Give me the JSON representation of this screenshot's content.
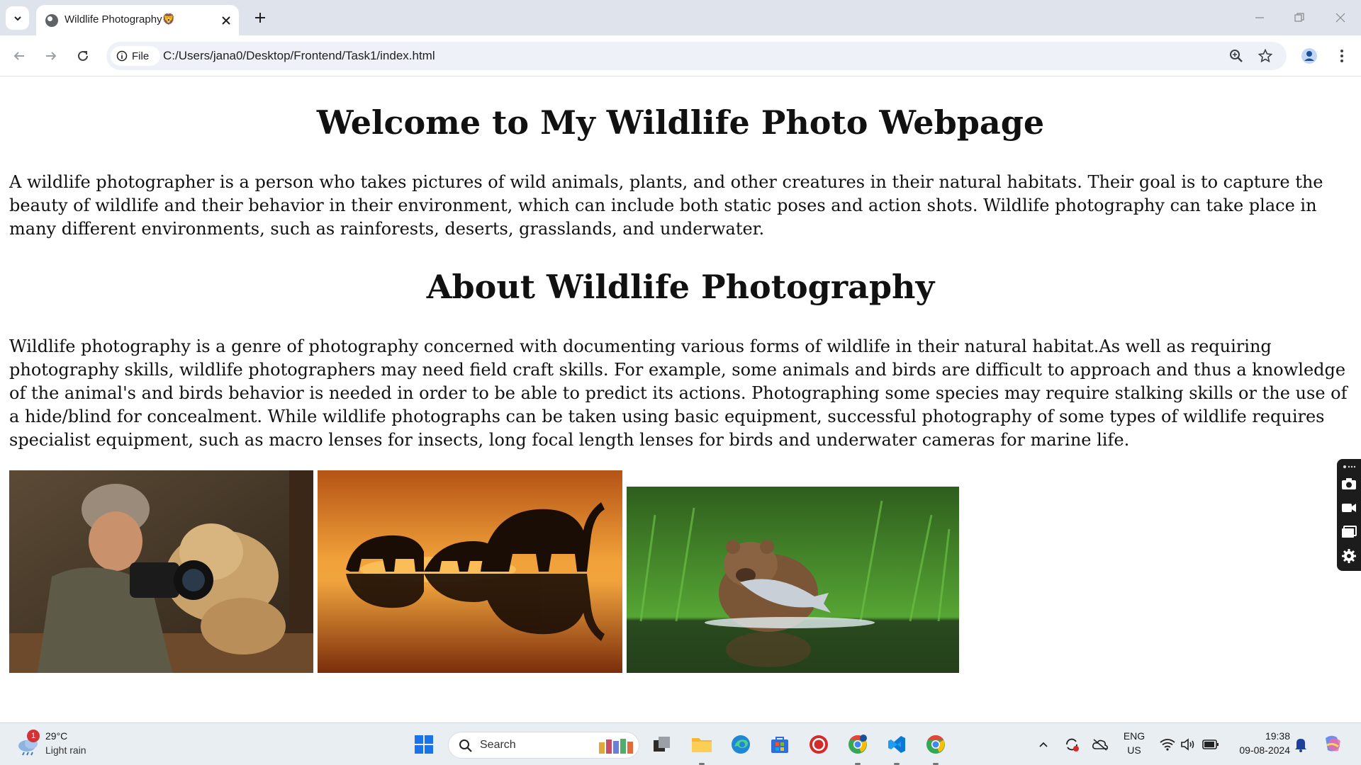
{
  "browser": {
    "tab": {
      "title": "Wildlife Photography🦁",
      "favicon": "globe-icon"
    },
    "address_chip": "File",
    "url": "C:/Users/jana0/Desktop/Frontend/Task1/index.html"
  },
  "page": {
    "heading": "Welcome to My Wildlife Photo Webpage",
    "intro": "A wildlife photographer is a person who takes pictures of wild animals, plants, and other creatures in their natural habitats. Their goal is to capture the beauty of wildlife and their behavior in their environment, which can include both static poses and action shots. Wildlife photography can take place in many different environments, such as rainforests, deserts, grasslands, and underwater.",
    "subheading": "About Wildlife Photography",
    "about": "Wildlife photography is a genre of photography concerned with documenting various forms of wildlife in their natural habitat.As well as requiring photography skills, wildlife photographers may need field craft skills. For example, some animals and birds are difficult to approach and thus a knowledge of the animal's and birds behavior is needed in order to be able to predict its actions. Photographing some species may require stalking skills or the use of a hide/blind for concealment. While wildlife photographs can be taken using basic equipment, successful photography of some types of wildlife requires specialist equipment, such as macro lenses for insects, long focal length lenses for birds and underwater cameras for marine life.",
    "images": [
      "photographer-with-lion",
      "elephants-at-sunset",
      "bear-catching-salmon"
    ]
  },
  "taskbar": {
    "weather": {
      "temp": "29°C",
      "condition": "Light rain",
      "badge": "1"
    },
    "search_label": "Search",
    "language": {
      "line1": "ENG",
      "line2": "US"
    },
    "time": "19:38",
    "date": "09-08-2024"
  }
}
